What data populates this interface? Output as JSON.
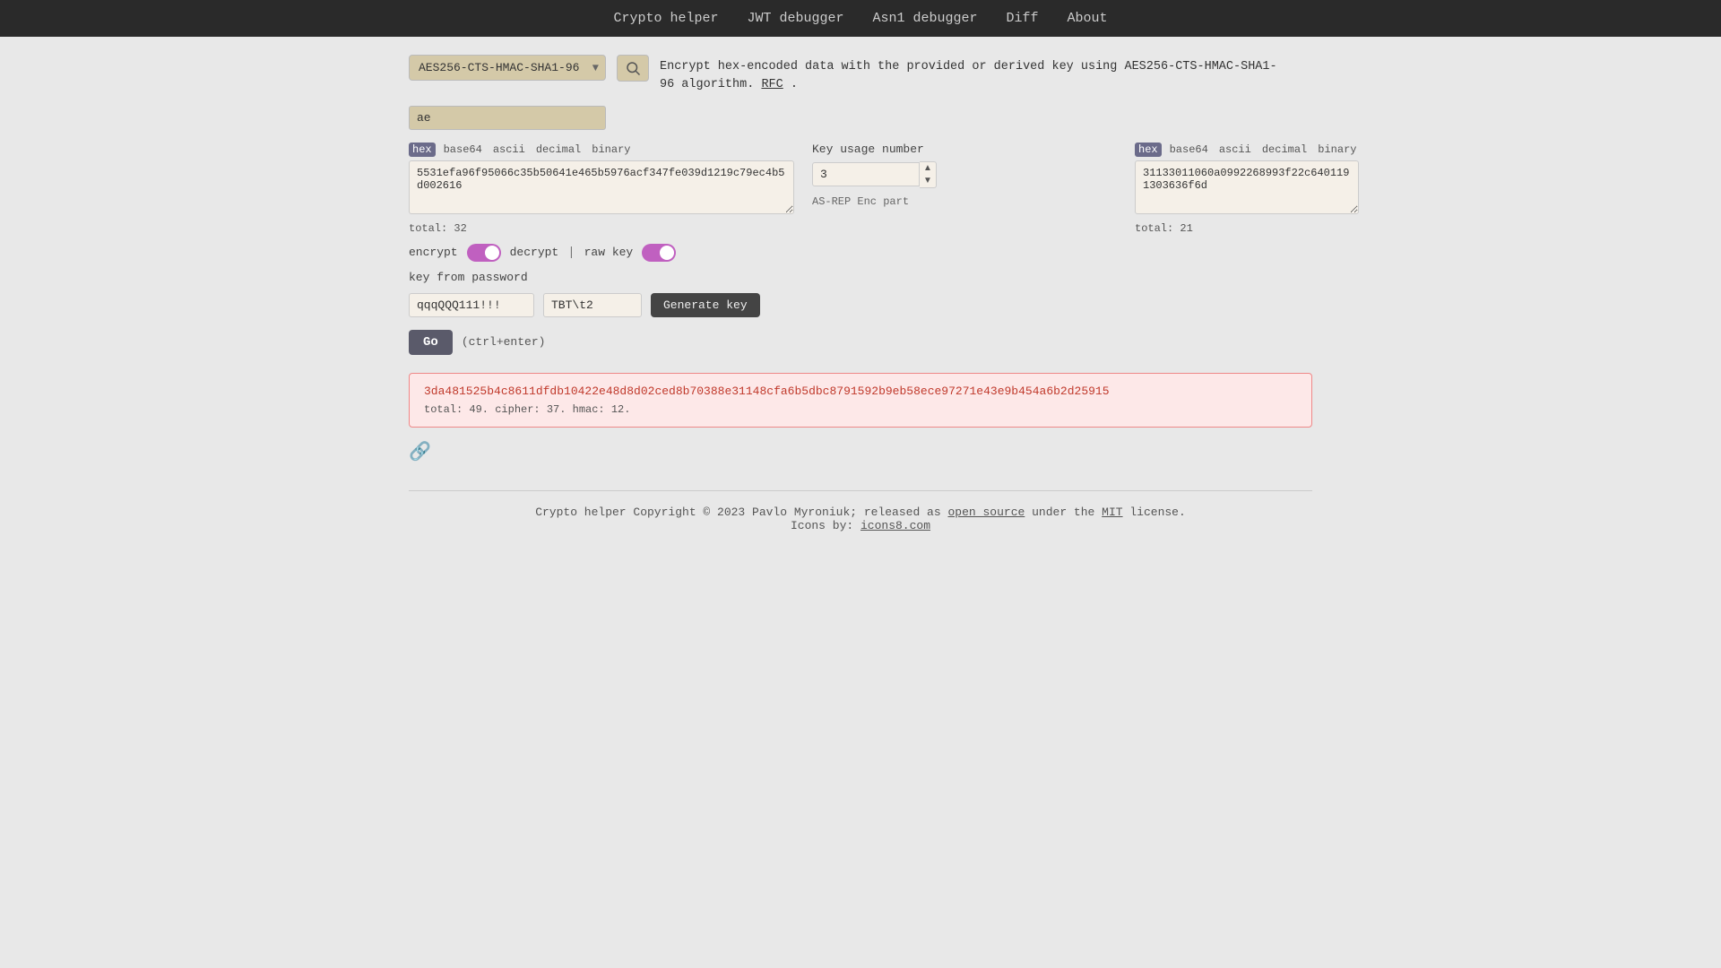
{
  "nav": {
    "items": [
      {
        "label": "Crypto helper",
        "href": "#"
      },
      {
        "label": "JWT debugger",
        "href": "#"
      },
      {
        "label": "Asn1 debugger",
        "href": "#"
      },
      {
        "label": "Diff",
        "href": "#"
      },
      {
        "label": "About",
        "href": "#"
      }
    ]
  },
  "algo": {
    "selected": "AES256-CTS-HMAC-SHA1-96",
    "description": "Encrypt hex-encoded data with the provided or derived key using AES256-CTS-HMAC-SHA1-96 algorithm.",
    "rfc_label": "RFC",
    "rfc_href": "#"
  },
  "input_value": "ae",
  "left_panel": {
    "formats": [
      "hex",
      "base64",
      "ascii",
      "decimal",
      "binary"
    ],
    "active_format": "hex",
    "textarea_value": "5531efa96f95066c35b50641e465b5976acf347fe039d1219c79ec4b5d002616",
    "total_label": "total: 32"
  },
  "middle_panel": {
    "key_usage_label": "Key usage number",
    "key_usage_value": "3",
    "asrep_label": "AS-REP Enc part"
  },
  "right_panel": {
    "formats": [
      "hex",
      "base64",
      "ascii",
      "decimal",
      "binary"
    ],
    "active_format": "hex",
    "textarea_value": "31133011060a0992268993f22c6401191303636f6d",
    "total_label": "total: 21"
  },
  "controls": {
    "encrypt_label": "encrypt",
    "decrypt_label": "decrypt",
    "raw_key_label": "raw key",
    "key_from_password_label": "key from password",
    "encrypt_on": true,
    "raw_key_on": true,
    "password_value": "qqqQQQ111!!!",
    "salt_value": "TBT\\t2",
    "gen_key_label": "Generate key"
  },
  "go_btn": {
    "label": "Go",
    "shortcut": "(ctrl+enter)"
  },
  "result": {
    "text": "3da481525b4c8611dfdb10422e48d8d02ced8b70388e31148cfa6b5dbc8791592b9eb58ece97271e43e9b454a6b2d25915",
    "meta": "total: 49. cipher: 37. hmac: 12."
  },
  "footer": {
    "copyright": "Crypto helper Copyright © 2023 Pavlo Myroniuk; released as",
    "open_source_label": "open source",
    "middle": "under the",
    "mit_label": "MIT",
    "end": "license.",
    "icons_label": "Icons by:",
    "icons_link": "icons8.com"
  }
}
